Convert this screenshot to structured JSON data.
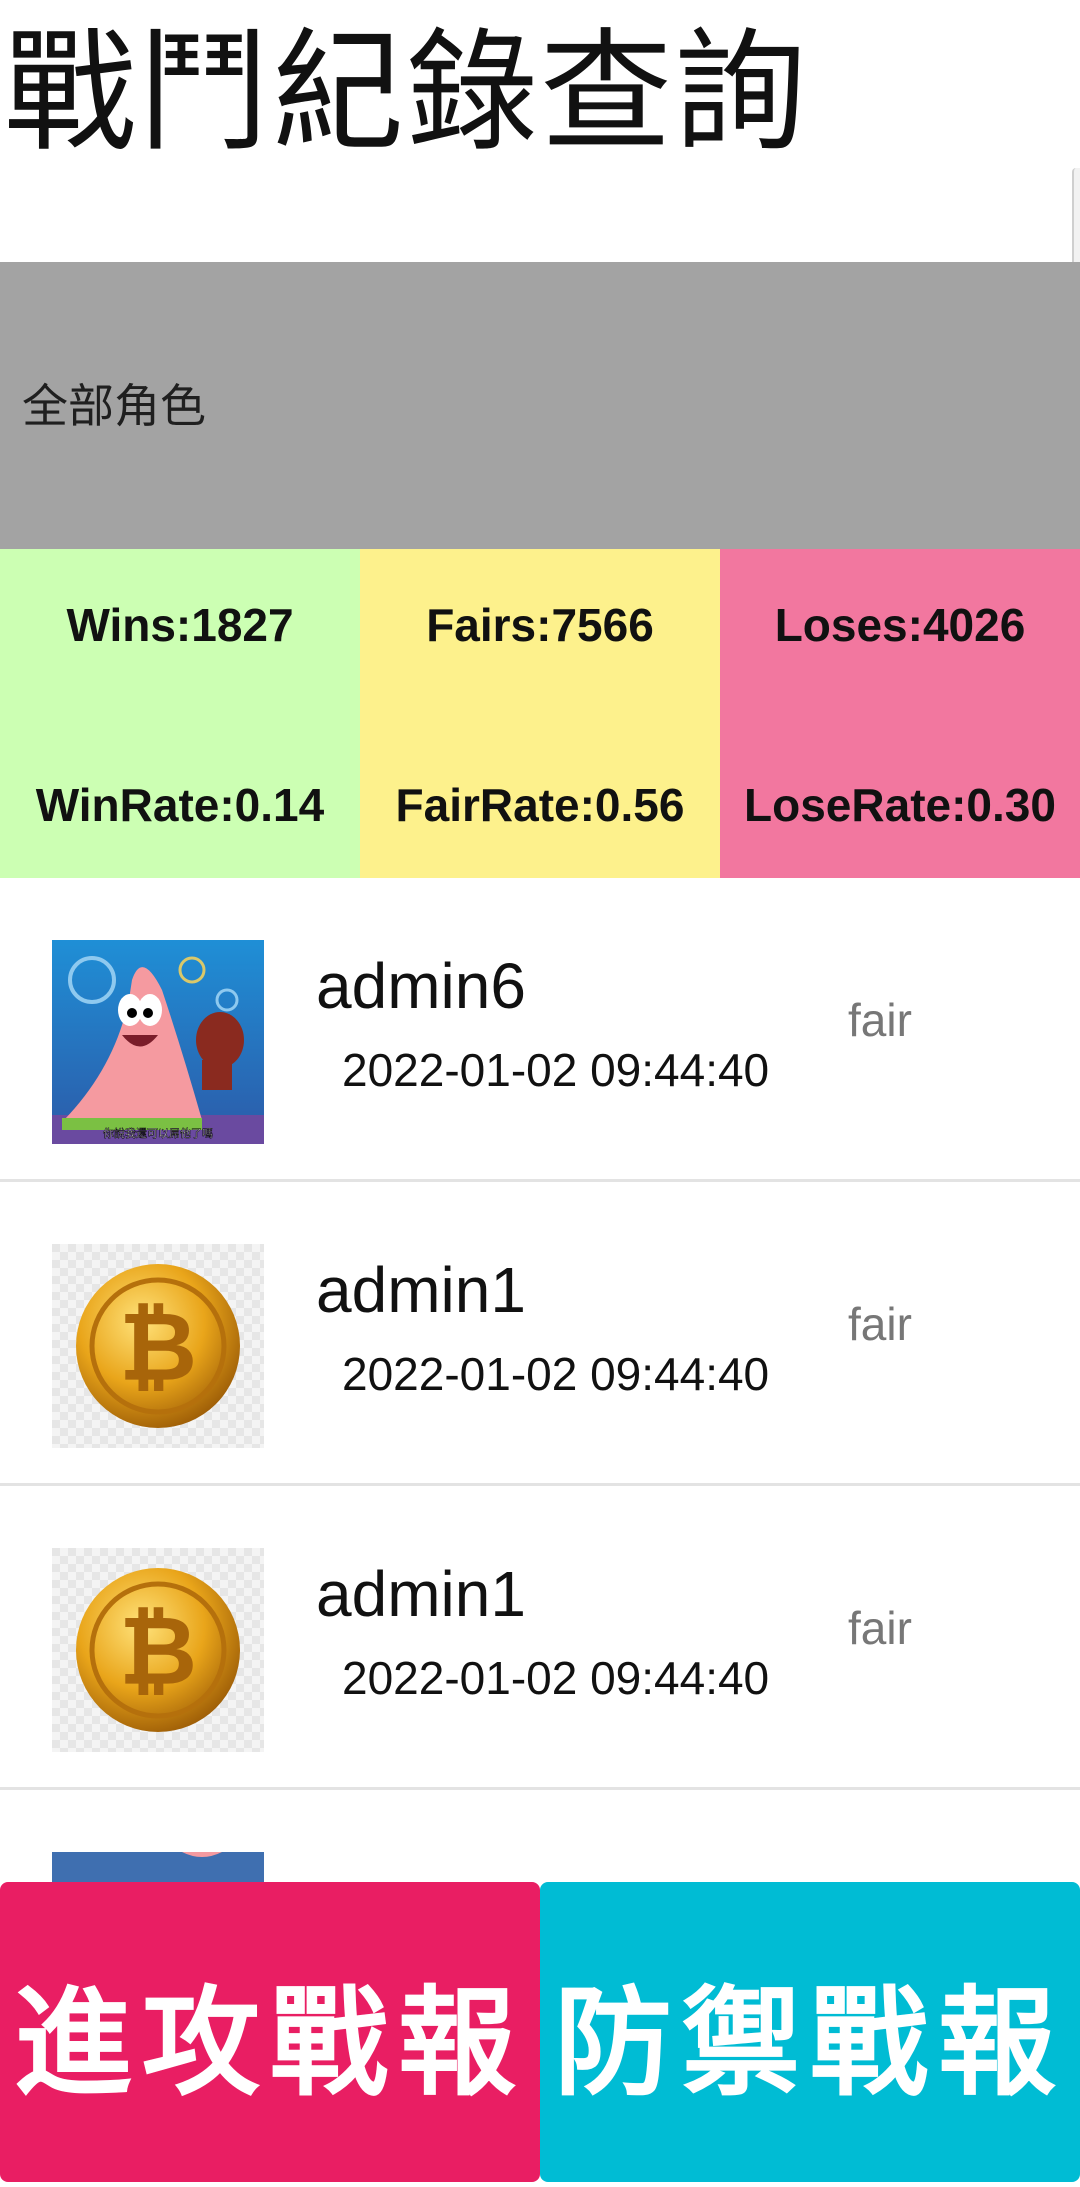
{
  "header": {
    "title": "戰鬥紀錄查詢"
  },
  "filter": {
    "selected_label": "全部角色"
  },
  "stats": {
    "wins": "Wins:1827",
    "fairs": "Fairs:7566",
    "loses": "Loses:4026",
    "win_rate": "WinRate:0.14",
    "fair_rate": "FairRate:0.56",
    "lose_rate": "LoseRate:0.30",
    "colors": {
      "wins": "#ccffb3",
      "fairs": "#fdf18c",
      "loses": "#f2779f"
    }
  },
  "records": [
    {
      "name": "admin6",
      "time": "2022-01-02 09:44:40",
      "result": "fair",
      "avatar": "cartoon-character-avatar",
      "avatar_caption": "你說我還可以屌他了嗎"
    },
    {
      "name": "admin1",
      "time": "2022-01-02 09:44:40",
      "result": "fair",
      "avatar": "bitcoin-avatar"
    },
    {
      "name": "admin1",
      "time": "2022-01-02 09:44:40",
      "result": "fair",
      "avatar": "bitcoin-avatar"
    }
  ],
  "actions": {
    "attack_label": "進攻戰報",
    "defense_label": "防禦戰報",
    "colors": {
      "attack": "#e91e63",
      "defense": "#00bcd4"
    }
  }
}
